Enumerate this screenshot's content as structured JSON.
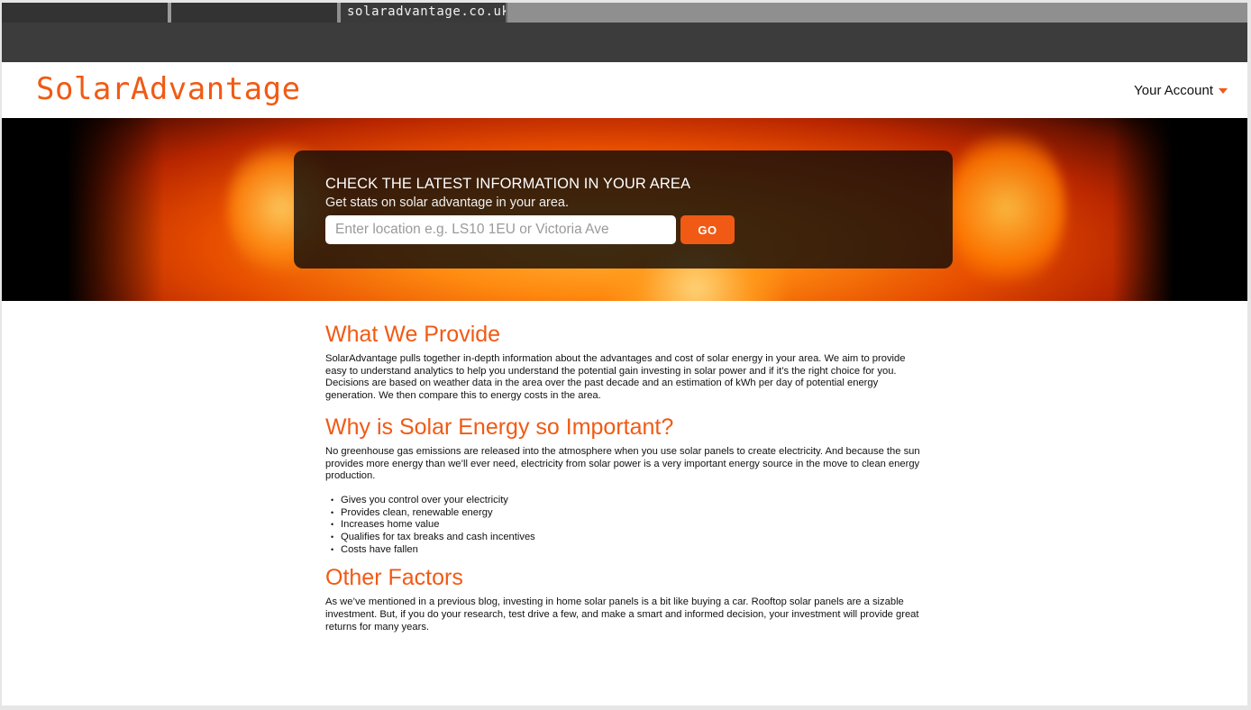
{
  "browser": {
    "active_tab_title": "solaradvantage.co.uk"
  },
  "header": {
    "logo": "SolarAdvantage",
    "account_label": "Your Account"
  },
  "hero": {
    "title": "CHECK THE LATEST INFORMATION IN YOUR AREA",
    "subtitle": "Get stats on solar advantage in your area.",
    "search_placeholder": "Enter location e.g. LS10 1EU or Victoria Ave",
    "search_value": "",
    "go_label": "GO"
  },
  "sections": {
    "provide": {
      "heading": "What We Provide",
      "body": "SolarAdvantage pulls together in-depth information about the advantages and cost of solar energy in your area. We aim to provide easy to understand analytics to help you understand the potential gain investing in solar power and if it’s the right choice for you. Decisions are based on weather data in the area over the past decade and an estimation of kWh per day of potential energy generation. We then compare this to energy costs in the area."
    },
    "why": {
      "heading": "Why is Solar Energy so Important?",
      "body": "No greenhouse gas emissions are released into the atmosphere when you use solar panels to create electricity. And because the sun provides more energy than we’ll ever need, electricity from solar power is a very important energy source in the move to clean energy production.",
      "bullets": [
        "Gives you control over your electricity",
        "Provides clean, renewable energy",
        "Increases home value",
        "Qualifies for tax breaks and cash incentives",
        "Costs have fallen"
      ]
    },
    "other": {
      "heading": "Other Factors",
      "body": "As we’ve mentioned in a previous blog, investing in home solar panels is a bit like buying a car. Rooftop solar panels are a sizable investment. But, if you do your research, test drive a few, and make a smart and informed decision, your investment will provide great returns for many years."
    }
  },
  "colors": {
    "brand_orange": "#f15a14"
  }
}
